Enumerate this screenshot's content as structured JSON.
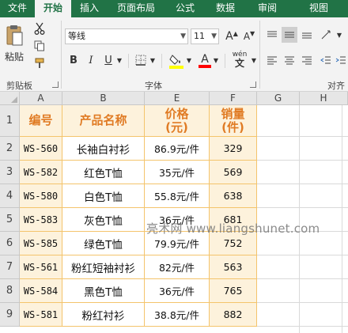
{
  "tabs": [
    "文件",
    "开始",
    "插入",
    "页面布局",
    "公式",
    "数据",
    "审阅",
    "视图"
  ],
  "active_tab": "开始",
  "ribbon": {
    "clipboard": {
      "paste_label": "粘贴",
      "group_label": "剪贴板"
    },
    "font": {
      "name": "等线",
      "size": "11",
      "grow_label": "A",
      "shrink_label": "A",
      "bold": "B",
      "italic": "I",
      "underline": "U",
      "font_color_glyph": "A",
      "wen_label": "wén",
      "group_label": "字体"
    },
    "alignment": {
      "group_label": "对齐"
    },
    "accent_colors": {
      "tabs_bg": "#217346",
      "highlight": "#ffff00",
      "font_color": "#ff0000"
    }
  },
  "sheet": {
    "columns": [
      "A",
      "B",
      "E",
      "F",
      "G",
      "H"
    ],
    "rows": [
      "1",
      "2",
      "3",
      "4",
      "5",
      "6",
      "7",
      "8",
      "9"
    ],
    "header": {
      "code": "编号",
      "name": "产品名称",
      "price_line1": "价格",
      "price_line2": "(元)",
      "sales_line1": "销量",
      "sales_line2": "(件)"
    },
    "data": [
      {
        "code": "WS-560",
        "name": "长袖白衬衫",
        "price": "86.9元/件",
        "sales": "329"
      },
      {
        "code": "WS-582",
        "name": "红色T恤",
        "price": "35元/件",
        "sales": "569"
      },
      {
        "code": "WS-580",
        "name": "白色T恤",
        "price": "55.8元/件",
        "sales": "638"
      },
      {
        "code": "WS-583",
        "name": "灰色T恤",
        "price": "36元/件",
        "sales": "681"
      },
      {
        "code": "WS-585",
        "name": "绿色T恤",
        "price": "79.9元/件",
        "sales": "752"
      },
      {
        "code": "WS-561",
        "name": "粉红短袖衬衫",
        "price": "82元/件",
        "sales": "563"
      },
      {
        "code": "WS-584",
        "name": "黑色T恤",
        "price": "36元/件",
        "sales": "765"
      },
      {
        "code": "WS-581",
        "name": "粉红衬衫",
        "price": "38.8元/件",
        "sales": "882"
      }
    ],
    "colors": {
      "fill_light": "#fdf2dc",
      "fill_white": "#ffffff",
      "border": "#f4c46c",
      "header_text": "#e07b24"
    }
  },
  "watermark": "亮术网 www.liangshunet.com"
}
